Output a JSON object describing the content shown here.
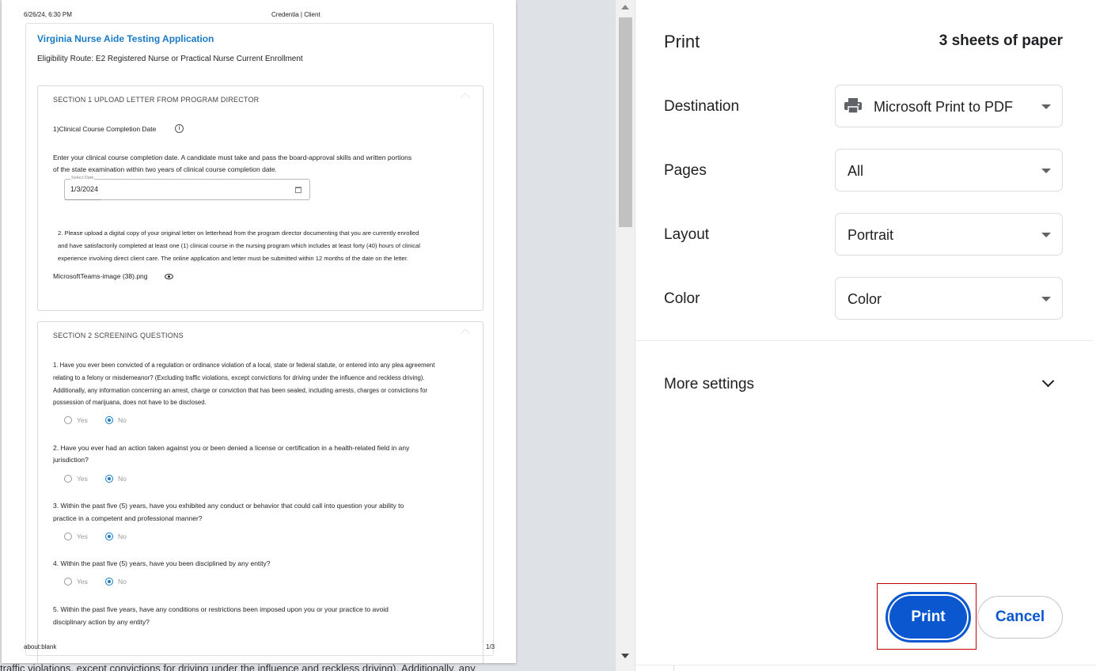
{
  "preview": {
    "header_datetime": "6/26/24, 6:30 PM",
    "header_title": "Credentia | Client",
    "footer_url": "about:blank",
    "footer_page": "1/3",
    "underlying_text": "traffic violations, except convictions for driving under the influence and reckless driving). Additionally, any",
    "form": {
      "title": "Virginia Nurse Aide Testing Application",
      "subtitle": "Eligibility Route: E2 Registered Nurse or Practical Nurse Current Enrollment",
      "section1": {
        "title": "SECTION 1  UPLOAD LETTER FROM PROGRAM DIRECTOR",
        "q1_label": "1)Clinical Course Completion Date",
        "q1_desc_line1": "Enter your clinical course completion date. A candidate must take and pass the board-approval skills and written portions",
        "q1_desc_line2": "of the state examination within two years of clinical course completion date.",
        "date_label": "Select Date",
        "date_value": "1/3/2024",
        "q2_line1": "2. Please upload a digital copy of your original letter on letterhead from the program director documenting that you are currently enrolled",
        "q2_line2": "and have satisfactorily completed at least one (1) clinical course in the nursing program which includes at least forty (40) hours of clinical",
        "q2_line3": "experience involving direct client care. The online application and letter must be submitted within 12 months of the date on the letter.",
        "file_name": "MicrosoftTeams-image (38).png"
      },
      "section2": {
        "title": "SECTION 2  SCREENING QUESTIONS",
        "yes_label": "Yes",
        "no_label": "No",
        "q1_line1": "1. Have you ever been convicted of a regulation or ordinance violation of a local, state or federal statute, or entered into any plea agreement",
        "q1_line2": "relating to a felony or misdemeanor? (Excluding traffic violations, except convictions for driving under the influence and reckless driving).",
        "q1_line3": "Additionally, any information concerning an arrest, charge or conviction that has been sealed, including arrests, charges or convictions for",
        "q1_line4": "possession of marijuana, does not have to be disclosed.",
        "q2_line1": "2. Have you ever had an action taken against you or been denied a license or certification in a health-related field in any",
        "q2_line2": "jurisdiction?",
        "q3_line1": "3. Within the past five (5) years, have you exhibited any conduct or behavior that could call into question your ability to",
        "q3_line2": "practice in a competent and professional manner?",
        "q4_line1": "4. Within the past five (5) years, have you been disciplined by any entity?",
        "q5_line1": "5. Within the past five years, have any conditions or restrictions been imposed upon you or your practice to avoid",
        "q5_line2": "disciplinary action by any entity?",
        "answers": [
          "No",
          "No",
          "No",
          "No"
        ]
      }
    }
  },
  "panel": {
    "title": "Print",
    "sheets": "3 sheets of paper",
    "destination_label": "Destination",
    "destination_value": "Microsoft Print to PDF",
    "pages_label": "Pages",
    "pages_value": "All",
    "layout_label": "Layout",
    "layout_value": "Portrait",
    "color_label": "Color",
    "color_value": "Color",
    "more_settings": "More settings",
    "print_button": "Print",
    "cancel_button": "Cancel"
  },
  "colors": {
    "accent": "#0b57d0",
    "form_title": "#1a7ac5",
    "highlight_border": "#c00000",
    "preview_bg": "#dee1e6"
  },
  "icons": [
    "printer-icon",
    "info-icon",
    "calendar-icon",
    "eye-icon",
    "chevron-down-icon",
    "scroll-up-arrow-icon",
    "scroll-down-arrow-icon"
  ]
}
